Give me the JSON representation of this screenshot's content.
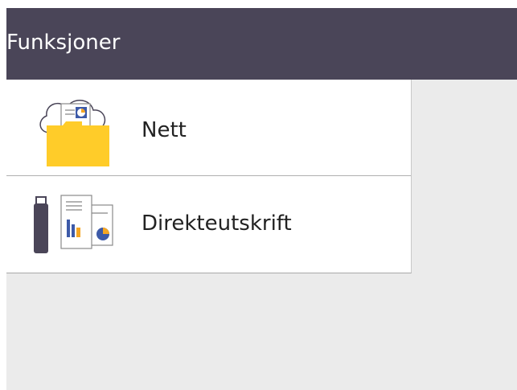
{
  "header": {
    "title": "Funksjoner"
  },
  "menu": {
    "items": [
      {
        "label": "Nett",
        "icon": "cloud-folder-icon"
      },
      {
        "label": "Direkteutskrift",
        "icon": "usb-print-icon"
      }
    ]
  },
  "colors": {
    "title_bar": "#4a4558",
    "background": "#ebebeb",
    "accent_yellow": "#ffcc29",
    "accent_blue": "#3d5aa8",
    "accent_orange": "#f5a623"
  }
}
